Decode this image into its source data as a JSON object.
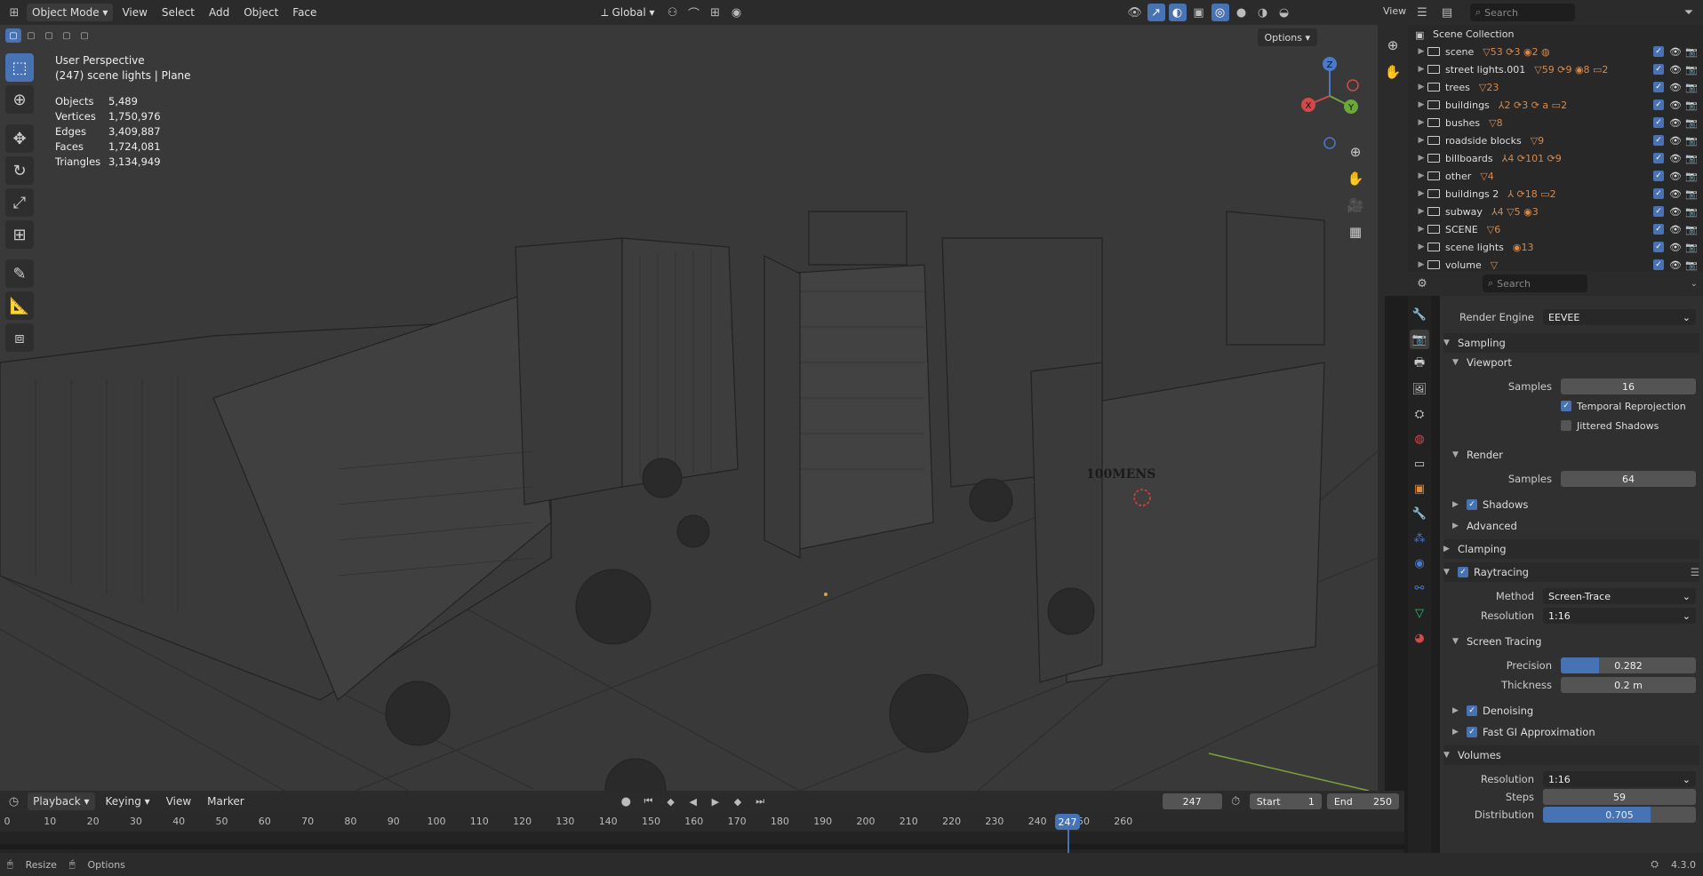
{
  "topbar": {
    "mode": "Object Mode",
    "menus": [
      "View",
      "Select",
      "Add",
      "Object",
      "Face"
    ],
    "orientation": "Global",
    "options": "Options"
  },
  "viewport": {
    "perspective_label": "User Perspective",
    "context_label": "(247) scene lights | Plane",
    "stats": [
      {
        "key": "Objects",
        "value": "5,489"
      },
      {
        "key": "Vertices",
        "value": "1,750,976"
      },
      {
        "key": "Edges",
        "value": "3,409,887"
      },
      {
        "key": "Faces",
        "value": "1,724,081"
      },
      {
        "key": "Triangles",
        "value": "3,134,949"
      }
    ],
    "sign_text": "100MENS",
    "gizmo": {
      "z": "Z",
      "x": "X",
      "y": "Y"
    }
  },
  "outliner": {
    "view_label": "View",
    "search_placeholder": "Search",
    "root": "Scene Collection",
    "items": [
      {
        "name": "scene",
        "badges": "▽53 ⟳3 ◉2 ◍"
      },
      {
        "name": "street lights.001",
        "badges": "▽59 ⟳9 ◉8 ▭2"
      },
      {
        "name": "trees",
        "badges": "▽23"
      },
      {
        "name": "buildings",
        "badges": "⅄2 ⟳3 ⟳ a ▭2"
      },
      {
        "name": "bushes",
        "badges": "▽8"
      },
      {
        "name": "roadside blocks",
        "badges": "▽9"
      },
      {
        "name": "billboards",
        "badges": "⅄4 ⟳101 ⟳9"
      },
      {
        "name": "other",
        "badges": "▽4"
      },
      {
        "name": "buildings 2",
        "badges": "⅄ ⟳18 ▭2"
      },
      {
        "name": "subway",
        "badges": "⅄4 ▽5 ◉3"
      },
      {
        "name": "SCENE",
        "badges": "▽6"
      },
      {
        "name": "scene lights",
        "badges": "◉13"
      },
      {
        "name": "volume",
        "badges": "▽"
      }
    ]
  },
  "properties": {
    "search_placeholder": "Search",
    "render_engine_label": "Render Engine",
    "render_engine": "EEVEE",
    "sampling": "Sampling",
    "viewport": "Viewport",
    "samples_label": "Samples",
    "viewport_samples": "16",
    "temporal_reprojection": "Temporal Reprojection",
    "jittered_shadows": "Jittered Shadows",
    "render": "Render",
    "render_samples": "64",
    "shadows": "Shadows",
    "advanced": "Advanced",
    "clamping": "Clamping",
    "raytracing": "Raytracing",
    "method_label": "Method",
    "method": "Screen-Trace",
    "resolution_label": "Resolution",
    "resolution": "1:16",
    "screen_tracing": "Screen Tracing",
    "precision_label": "Precision",
    "precision": "0.282",
    "precision_frac": 0.282,
    "thickness_label": "Thickness",
    "thickness": "0.2 m",
    "denoising": "Denoising",
    "fast_gi": "Fast GI Approximation",
    "volumes": "Volumes",
    "vol_resolution": "1:16",
    "steps_label": "Steps",
    "steps": "59",
    "distribution_label": "Distribution",
    "distribution": "0.705",
    "distribution_frac": 0.705
  },
  "timeline": {
    "menus": [
      "Playback",
      "Keying",
      "View",
      "Marker"
    ],
    "current_frame": "247",
    "start_label": "Start",
    "start": "1",
    "end_label": "End",
    "end": "250",
    "ticks": [
      "0",
      "10",
      "20",
      "30",
      "40",
      "50",
      "60",
      "70",
      "80",
      "90",
      "100",
      "110",
      "120",
      "130",
      "140",
      "150",
      "160",
      "170",
      "180",
      "190",
      "200",
      "210",
      "220",
      "230",
      "240",
      "250",
      "260"
    ]
  },
  "statusbar": {
    "resize": "Resize",
    "options": "Options",
    "version": "4.3.0"
  },
  "colors": {
    "accent": "#4772b3",
    "orange": "#d98a4a"
  }
}
